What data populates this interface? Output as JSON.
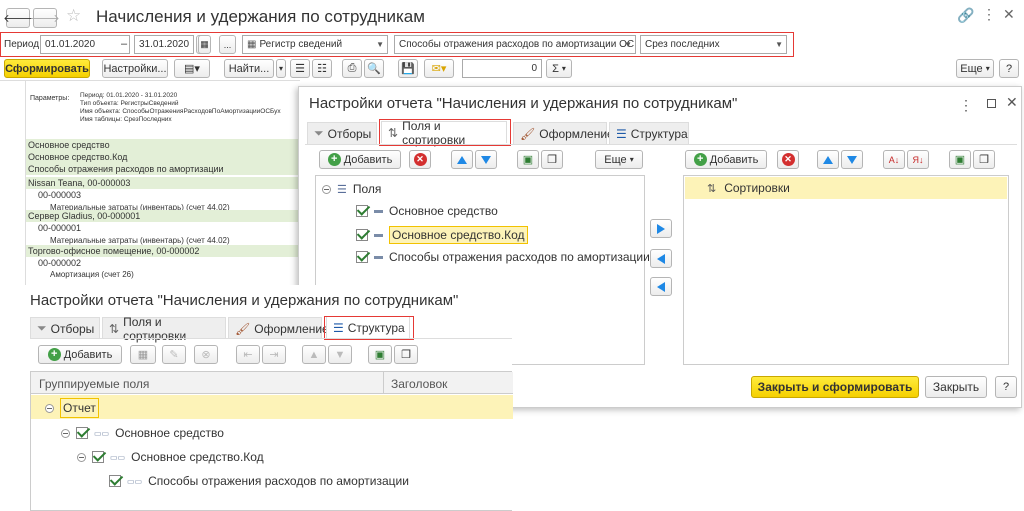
{
  "window": {
    "title": "Начисления и удержания по сотрудникам"
  },
  "period": {
    "label": "Период:",
    "from": "01.01.2020",
    "dash": "–",
    "to": "31.01.2020",
    "ellipsis": "...",
    "register": "Регистр сведений",
    "object": "Способы отражения расходов по амортизации ОС (б",
    "table": "Срез последних"
  },
  "toolbar": {
    "generate": "Сформировать",
    "settings": "Настройки...",
    "find": "Найти...",
    "number": "0",
    "sigma": "Σ",
    "more": "Еще",
    "help": "?"
  },
  "report": {
    "params_label": "Параметры:",
    "params": [
      "Период: 01.01.2020 - 31.01.2020",
      "Тип объекта: РегистрыСведений",
      "Имя объекта: СпособыОтраженияРасходовПоАмортизацииОСБух",
      "Имя таблицы: СрезПоследних"
    ],
    "headers": [
      "Основное средство",
      "Основное средство.Код",
      "Способы отражения расходов по амортизации"
    ],
    "rows": [
      {
        "text": "Nissan Teana, 00-000003",
        "level": 0
      },
      {
        "text": "00-000003",
        "level": 1
      },
      {
        "text": "Материальные затраты (инвентарь) (счет 44.02)",
        "level": 2
      },
      {
        "text": "Сервер Gladius, 00-000001",
        "level": 0
      },
      {
        "text": "00-000001",
        "level": 1
      },
      {
        "text": "Материальные затраты (инвентарь) (счет 44.02)",
        "level": 2
      },
      {
        "text": "Торгово-офисное помещение, 00-000002",
        "level": 0
      },
      {
        "text": "00-000002",
        "level": 1
      },
      {
        "text": "Амортизация (счет 26)",
        "level": 2
      }
    ]
  },
  "dialog1": {
    "title": "Настройки отчета \"Начисления и удержания по сотрудникам\"",
    "menu": "⋮",
    "tabs": [
      "Отборы",
      "Поля и сортировки",
      "Оформление",
      "Структура"
    ],
    "add": "Добавить",
    "more": "Еще",
    "fields_root": "Поля",
    "fields": [
      "Основное средство",
      "Основное средство.Код",
      "Способы отражения расходов по амортизации"
    ],
    "sort_root": "Сортировки",
    "close_generate": "Закрыть и сформировать",
    "close": "Закрыть",
    "help": "?"
  },
  "dialog2": {
    "title": "Настройки отчета \"Начисления и удержания по сотрудникам\"",
    "tabs": [
      "Отборы",
      "Поля и сортировки",
      "Оформление",
      "Структура"
    ],
    "add": "Добавить",
    "col1": "Группируемые поля",
    "col2": "Заголовок",
    "root": "Отчет",
    "items": [
      "Основное средство",
      "Основное средство.Код",
      "Способы отражения расходов по амортизации"
    ]
  },
  "colors": {
    "accent": "#f5d000",
    "red": "#e53935",
    "highlight": "#fdf3b8",
    "group": "#e3efd7"
  }
}
